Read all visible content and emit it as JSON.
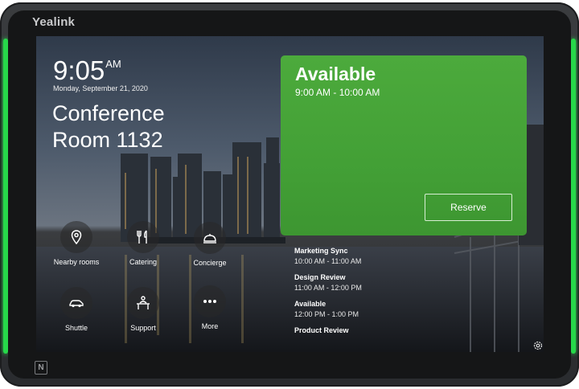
{
  "device": {
    "brand": "Yealink",
    "nfc_label": "N",
    "led_color": "#27d84a"
  },
  "clock": {
    "time": "9:05",
    "ampm": "AM",
    "date": "Monday, September 21, 2020"
  },
  "room": {
    "name": "Conference Room 1132"
  },
  "status": {
    "title": "Available",
    "time_range": "9:00 AM - 10:00 AM",
    "reserve_label": "Reserve",
    "color": "#48a43a"
  },
  "quick_actions": [
    {
      "label": "Nearby rooms",
      "icon": "location-pin-icon"
    },
    {
      "label": "Catering",
      "icon": "fork-knife-icon"
    },
    {
      "label": "Concierge",
      "icon": "concierge-bell-icon"
    },
    {
      "label": "Shuttle",
      "icon": "car-icon"
    },
    {
      "label": "Support",
      "icon": "support-desk-icon"
    },
    {
      "label": "More",
      "icon": "more-dots-icon"
    }
  ],
  "schedule": [
    {
      "title": "Marketing Sync",
      "time": "10:00 AM - 11:00 AM"
    },
    {
      "title": "Design Review",
      "time": "11:00 AM - 12:00 PM"
    },
    {
      "title": "Available",
      "time": "12:00 PM - 1:00 PM"
    },
    {
      "title": "Product Review",
      "time": ""
    }
  ]
}
